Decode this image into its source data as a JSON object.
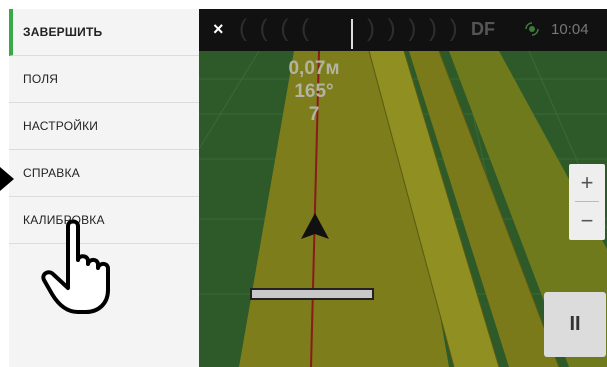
{
  "menu": {
    "items": [
      {
        "label": "ЗАВЕРШИТЬ",
        "active": true
      },
      {
        "label": "ПОЛЯ",
        "active": false
      },
      {
        "label": "НАСТРОЙКИ",
        "active": false
      },
      {
        "label": "СПРАВКА",
        "active": false
      },
      {
        "label": "КАЛИБРОВКА",
        "active": false
      }
    ]
  },
  "topbar": {
    "close_symbol": "×",
    "lightbar_left": "( ( ( (",
    "lightbar_right": ") ) ) ) )",
    "mode_label": "DF",
    "gps_icon": "satellite-icon",
    "time": "10:04"
  },
  "readout": {
    "offset": "0,07м",
    "heading": "165°",
    "line_number": "7"
  },
  "zoom": {
    "in_label": "+",
    "out_label": "−"
  },
  "pause_label": "II",
  "colors": {
    "active_accent": "#3aa84a",
    "field_green": "#2f6b2a",
    "swath_yellow": "#8a8a1e",
    "guidance_line": "#8b1a1a"
  }
}
